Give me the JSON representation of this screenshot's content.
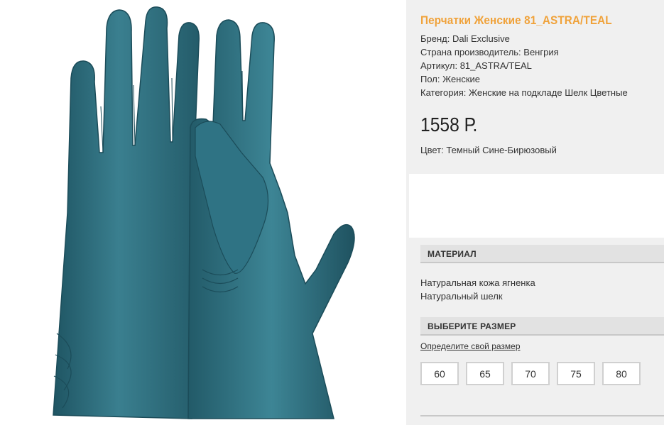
{
  "product": {
    "title": "Перчатки Женские 81_ASTRA/TEAL",
    "image_alt": "gloves-image",
    "attributes": [
      "Бренд: Dali Exclusive",
      "Страна производитель: Венгрия",
      "Артикул: 81_ASTRA/TEAL",
      "Пол: Женские",
      "Категория: Женские на подкладе Шелк Цветные"
    ],
    "price": "1558 Р.",
    "color": "Цвет: Темный Сине-Бирюзовый"
  },
  "material": {
    "header": "МАТЕРИАЛ",
    "items": [
      "Натуральная кожа ягненка",
      "Натуральный шелк"
    ]
  },
  "size": {
    "header": "ВЫБЕРИТЕ РАЗМЕР",
    "link": "Определите свой размер",
    "options": [
      "60",
      "65",
      "70",
      "75",
      "80"
    ]
  },
  "colors": {
    "title": "#f0a23a",
    "panel": "#f0f0f0",
    "header_bg": "#e2e2e2",
    "glove": "#2f6f7e"
  },
  "icons": [
    "gloves-illustration"
  ]
}
